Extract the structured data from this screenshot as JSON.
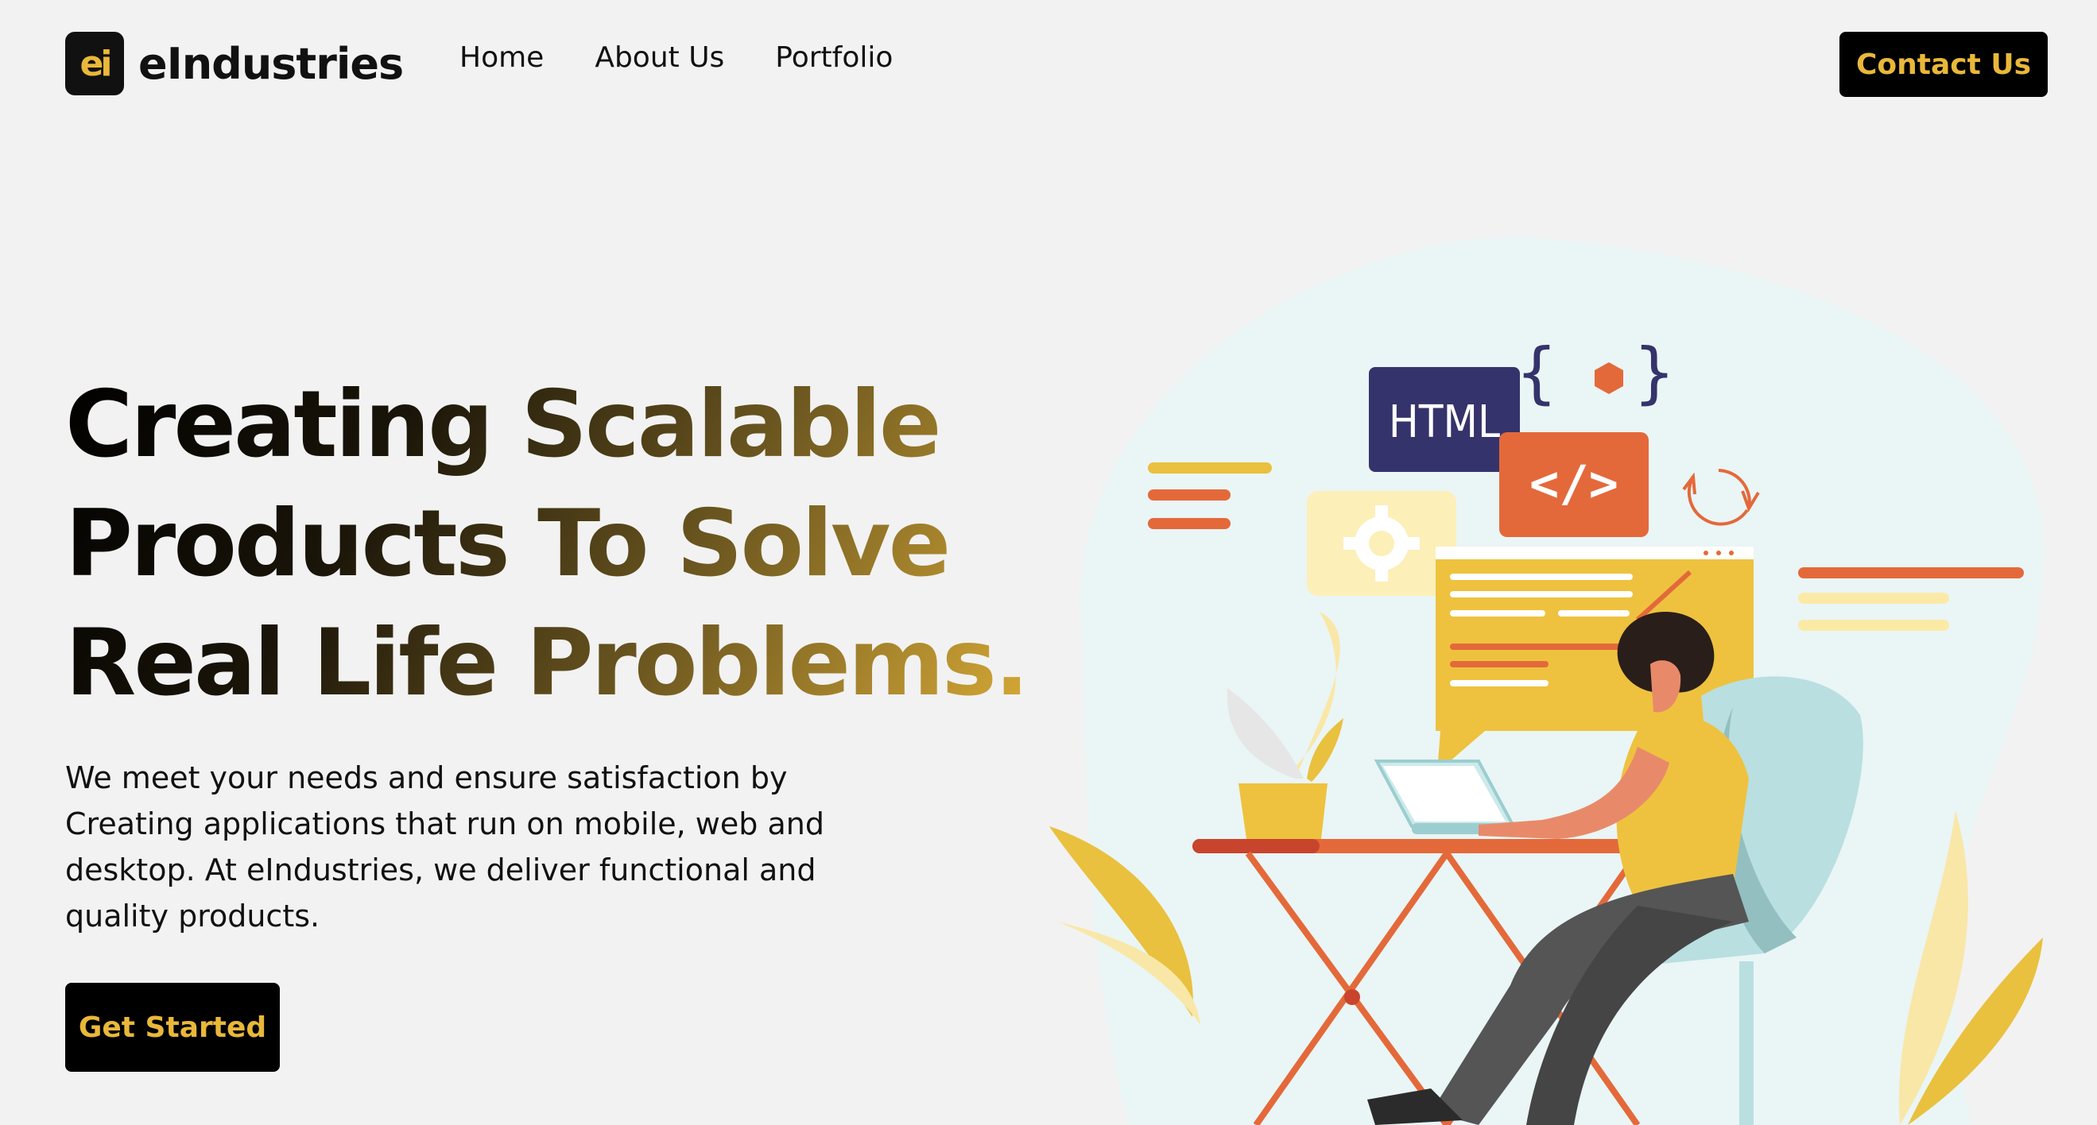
{
  "brand": {
    "logo_mark": "ei",
    "name": "eIndustries"
  },
  "nav": {
    "items": [
      "Home",
      "About Us",
      "Portfolio"
    ]
  },
  "header": {
    "contact_label": "Contact Us"
  },
  "hero": {
    "title": "Creating Scalable Products To Solve Real Life Problems.",
    "subtitle": "We meet your needs and ensure satisfaction by Creating applications that run on mobile, web and desktop. At eIndustries, we deliver functional and quality products.",
    "cta_label": "Get Started"
  },
  "illustration": {
    "html_tag": "HTML",
    "code_tag": "</>",
    "braces": "{ }"
  },
  "colors": {
    "accent": "#e9b83a",
    "dark": "#000000",
    "background": "#f2f2f2",
    "orange": "#e4693a",
    "navy": "#35336b",
    "mint": "#b9dfe1"
  }
}
